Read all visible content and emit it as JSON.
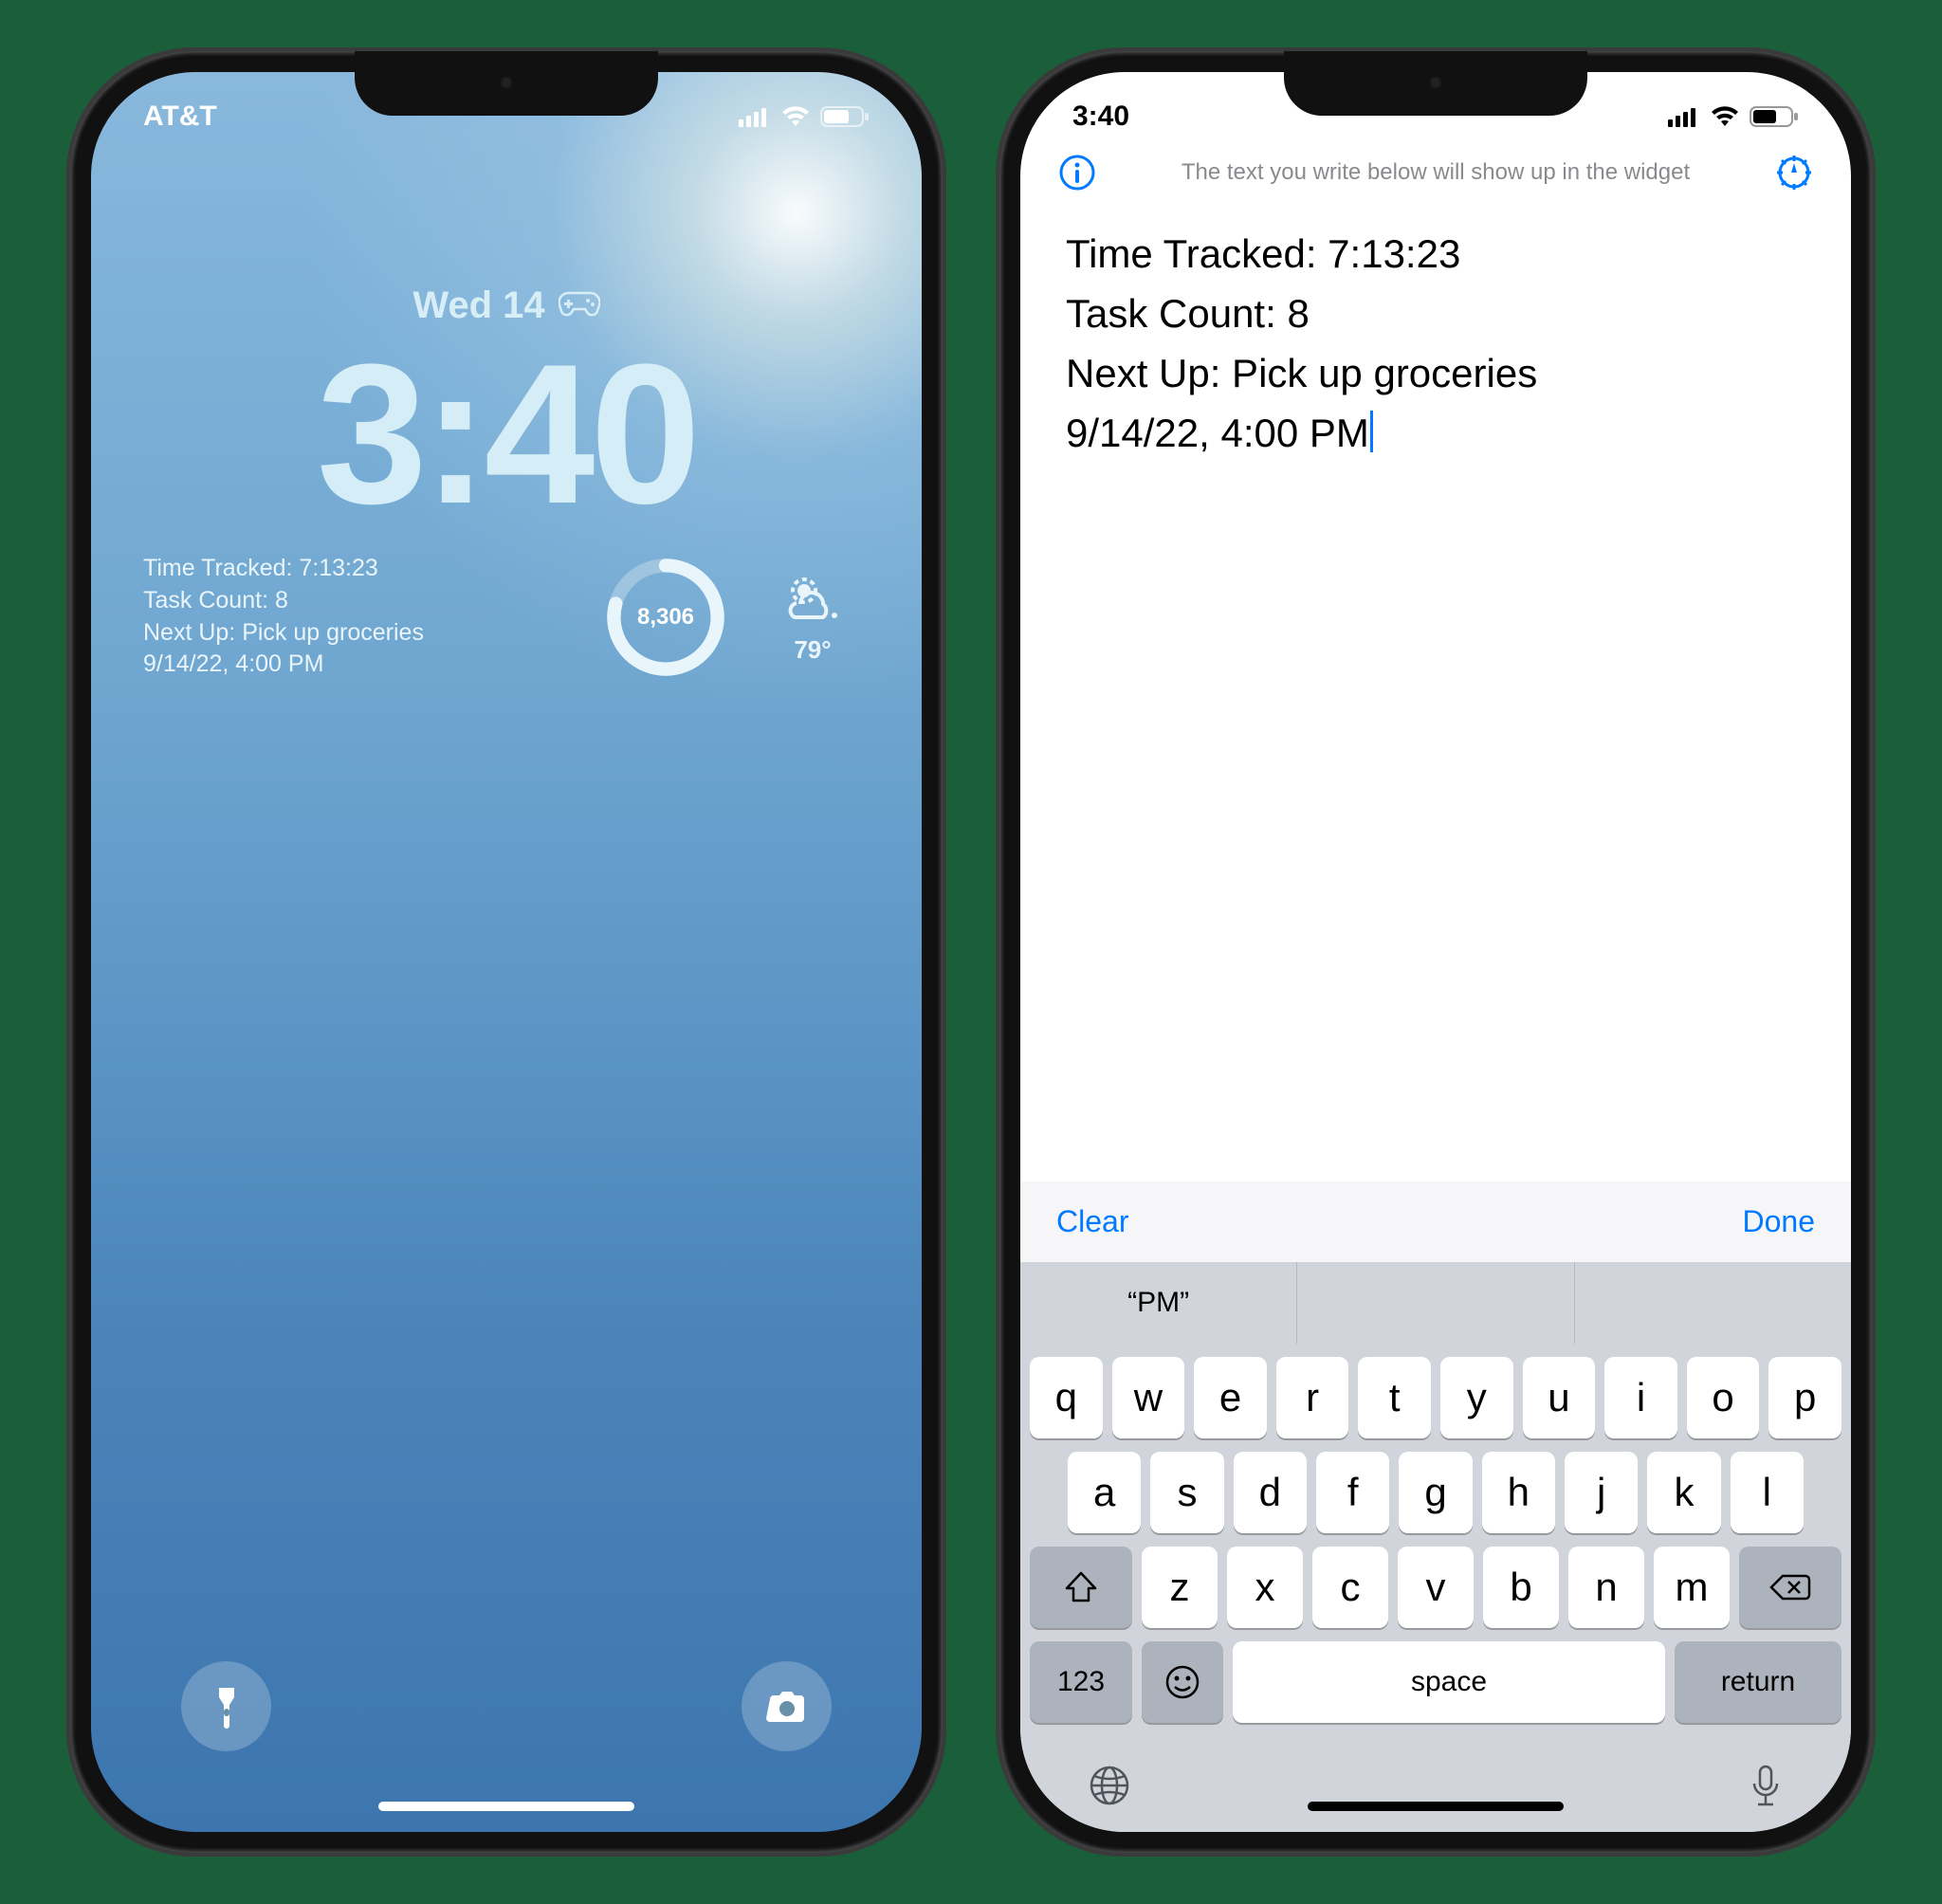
{
  "left": {
    "carrier": "AT&T",
    "date": "Wed 14",
    "time": "3:40",
    "widget_text": {
      "line1": "Time Tracked: 7:13:23",
      "line2": "Task Count: 8",
      "line3": "Next Up: Pick up groceries",
      "line4": "9/14/22, 4:00 PM"
    },
    "steps": "8,306",
    "temp": "79°"
  },
  "right": {
    "status_time": "3:40",
    "hint": "The text you write below will show up in the widget",
    "editor": {
      "line1": "Time Tracked: 7:13:23",
      "line2": "Task Count: 8",
      "line3": "Next Up: Pick up groceries",
      "line4": "9/14/22, 4:00 PM"
    },
    "accessory": {
      "clear": "Clear",
      "done": "Done"
    },
    "suggestion": "“PM”",
    "keys": {
      "row1": [
        "q",
        "w",
        "e",
        "r",
        "t",
        "y",
        "u",
        "i",
        "o",
        "p"
      ],
      "row2": [
        "a",
        "s",
        "d",
        "f",
        "g",
        "h",
        "j",
        "k",
        "l"
      ],
      "row3": [
        "z",
        "x",
        "c",
        "v",
        "b",
        "n",
        "m"
      ],
      "num": "123",
      "space": "space",
      "return": "return"
    }
  }
}
